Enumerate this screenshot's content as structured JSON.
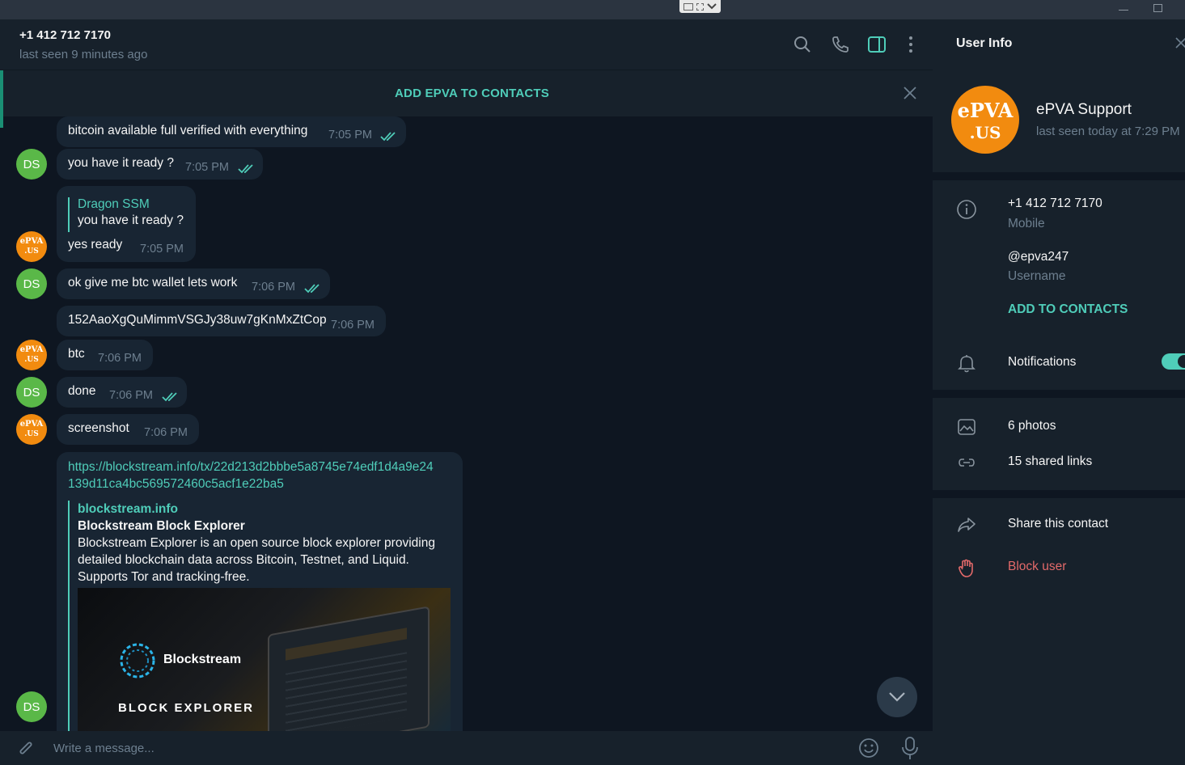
{
  "header": {
    "title": "+1 412 712 7170",
    "status": "last seen 9 minutes ago"
  },
  "add_bar": {
    "label": "ADD EPVA TO CONTACTS"
  },
  "avatars": {
    "ds_initials": "DS",
    "epva_line1": "ePVA",
    "epva_line2": ".US"
  },
  "messages": [
    {
      "text": "bitcoin available full verified with everything",
      "time": "7:05 PM"
    },
    {
      "text": "you have it ready ?",
      "time": "7:05 PM"
    },
    {
      "quote_author": "Dragon SSM",
      "quote_text": "you have it ready ?",
      "text": "yes ready",
      "time": "7:05 PM"
    },
    {
      "text": "ok give me btc wallet lets work",
      "time": "7:06 PM"
    },
    {
      "text": "152AaoXgQuMimmVSGJy38uw7gKnMxZtCop",
      "time": "7:06 PM"
    },
    {
      "text": "btc",
      "time": "7:06 PM"
    },
    {
      "text": "done",
      "time": "7:06 PM"
    },
    {
      "text": "screenshot",
      "time": "7:06 PM"
    }
  ],
  "link_message": {
    "url_line1": "https://blockstream.info/tx/22d213d2bbbe5a8745e74edf1d4a9e24",
    "url_line2": "139d11ca4bc569572460c5acf1e22ba5",
    "site": "blockstream.info",
    "title": "Blockstream Block Explorer",
    "desc1": "Blockstream Explorer is an open source block explorer providing",
    "desc2": "detailed blockchain data across Bitcoin, Testnet, and Liquid.",
    "desc3": "Supports Tor and tracking-free.",
    "preview_brand": "Blockstream",
    "preview_caption": "BLOCK EXPLORER"
  },
  "composer": {
    "placeholder": "Write a message..."
  },
  "panel": {
    "title": "User Info",
    "name": "ePVA Support",
    "status": "last seen today at 7:29 PM",
    "phone": "+1 412 712 7170",
    "phone_label": "Mobile",
    "username": "@epva247",
    "username_label": "Username",
    "add_contacts": "ADD TO CONTACTS",
    "notifications": "Notifications",
    "notifications_on": true,
    "photos": "6 photos",
    "links": "15 shared links",
    "share": "Share this contact",
    "block": "Block user"
  },
  "colors": {
    "accent": "#4fcdb9",
    "danger": "#e46a6a",
    "bubble": "#182533",
    "bg": "#0e1621",
    "panel": "#17212b",
    "orange": "#f28b0f",
    "green": "#5ab848"
  }
}
